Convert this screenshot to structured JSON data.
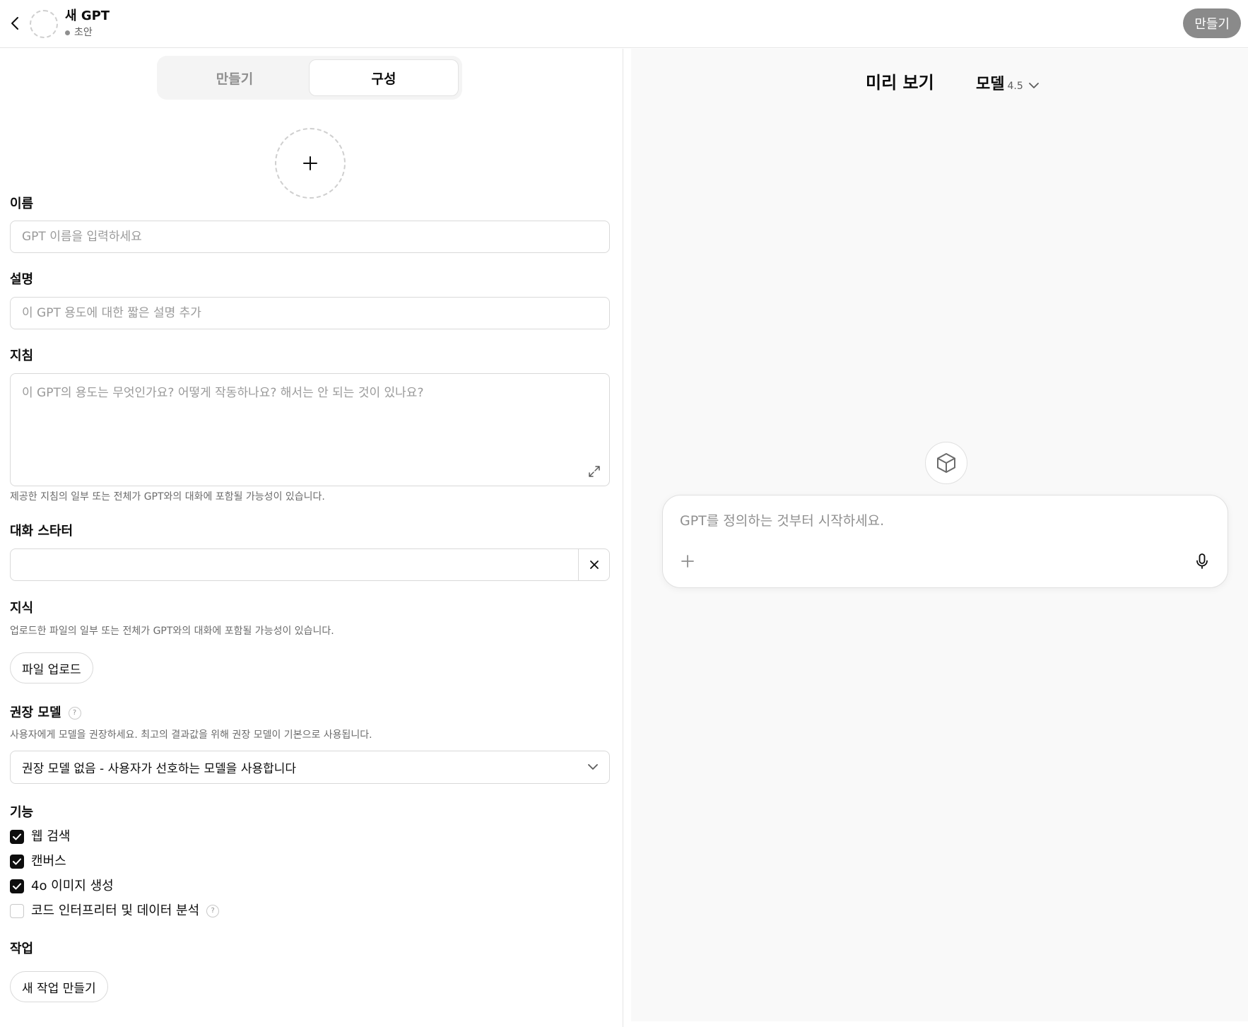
{
  "header": {
    "title": "새 GPT",
    "status": "초안",
    "create_label": "만들기"
  },
  "tabs": [
    {
      "label": "만들기",
      "active": false
    },
    {
      "label": "구성",
      "active": true
    }
  ],
  "form": {
    "name": {
      "label": "이름",
      "placeholder": "GPT 이름을 입력하세요",
      "value": ""
    },
    "description": {
      "label": "설명",
      "placeholder": "이 GPT 용도에 대한 짧은 설명 추가",
      "value": ""
    },
    "instructions": {
      "label": "지침",
      "placeholder": "이 GPT의 용도는 무엇인가요? 어떻게 작동하나요? 해서는 안 되는 것이 있나요?",
      "help": "제공한 지침의 일부 또는 전체가 GPT와의 대화에 포함될 가능성이 있습니다."
    },
    "starters": {
      "label": "대화 스타터",
      "value": ""
    },
    "knowledge": {
      "label": "지식",
      "help": "업로드한 파일의 일부 또는 전체가 GPT와의 대화에 포함될 가능성이 있습니다.",
      "upload_label": "파일 업로드"
    },
    "recommended_model": {
      "label": "권장 모델",
      "help": "사용자에게 모델을 권장하세요. 최고의 결과값을 위해 권장 모델이 기본으로 사용됩니다.",
      "selected": "권장 모델 없음 - 사용자가 선호하는 모델을 사용합니다"
    },
    "capabilities": {
      "label": "기능",
      "items": [
        {
          "label": "웹 검색",
          "checked": true
        },
        {
          "label": "캔버스",
          "checked": true
        },
        {
          "label": "4o 이미지 생성",
          "checked": true
        },
        {
          "label": "코드 인터프리터 및 데이터 분석",
          "checked": false
        }
      ]
    },
    "actions": {
      "label": "작업",
      "create_label": "새 작업 만들기"
    }
  },
  "preview": {
    "title": "미리 보기",
    "model_label": "모델",
    "model_version": "4.5",
    "composer_placeholder": "GPT를 정의하는 것부터 시작하세요."
  },
  "colors": {
    "accent": "#0d0d0d",
    "create_button": "#8a8a8a",
    "preview_bg": "#f9f9f9"
  }
}
